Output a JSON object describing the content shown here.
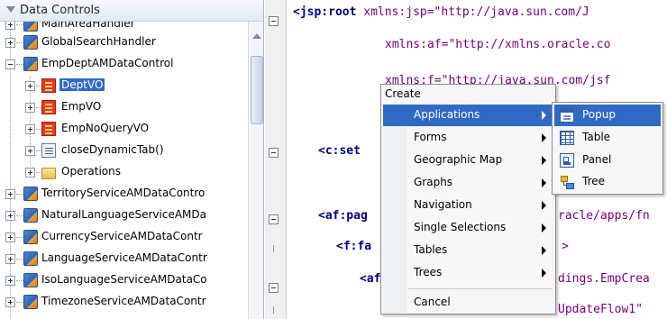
{
  "panel": {
    "title": "Data Controls"
  },
  "tree": {
    "items": [
      {
        "label": "MainAreaHandler",
        "icon": "data-control-icon"
      },
      {
        "label": "GlobalSearchHandler",
        "icon": "data-control-icon"
      },
      {
        "label": "EmpDeptAMDataControl",
        "icon": "data-control-icon"
      },
      {
        "label": "DeptVO",
        "icon": "view-object-icon",
        "selected": true
      },
      {
        "label": "EmpVO",
        "icon": "view-object-icon"
      },
      {
        "label": "EmpNoQueryVO",
        "icon": "view-object-icon"
      },
      {
        "label": "closeDynamicTab()",
        "icon": "method-icon"
      },
      {
        "label": "Operations",
        "icon": "folder-icon"
      },
      {
        "label": "TerritoryServiceAMDataContro",
        "icon": "data-control-icon"
      },
      {
        "label": "NaturalLanguageServiceAMDa",
        "icon": "data-control-icon"
      },
      {
        "label": "CurrencyServiceAMDataContr",
        "icon": "data-control-icon"
      },
      {
        "label": "LanguageServiceAMDataContr",
        "icon": "data-control-icon"
      },
      {
        "label": "IsoLanguageServiceAMDataCo",
        "icon": "data-control-icon"
      },
      {
        "label": "TimezoneServiceAMDataContr",
        "icon": "data-control-icon"
      }
    ]
  },
  "editor": {
    "lines": [
      {
        "tag": "<jsp:root",
        "rest": " xmlns:jsp=\"http://java.sun.com/J"
      },
      {
        "tag": "",
        "rest": "xmlns:af=\"http://xmlns.oracle.co"
      },
      {
        "tag": "",
        "rest": "xmlns:f=\"http://java.sun.com/jsf"
      },
      {
        "tag": "<c:set",
        "rest": ""
      },
      {
        "tag": "<af:pag",
        "rest": ""
      },
      {
        "tag": "<f:fa",
        "rest": ""
      },
      {
        "tag": "<af",
        "rest": ""
      },
      {
        "tag": "",
        "rest": "racle/apps/fn"
      },
      {
        "tag": "",
        "rest": ">"
      },
      {
        "tag": "",
        "rest": "dings.EmpCrea"
      },
      {
        "tag": "",
        "rest": "UpdateFlow1\""
      }
    ]
  },
  "context_menu": {
    "title": "Create",
    "items": [
      {
        "label": "Applications",
        "submenu": true,
        "active": true
      },
      {
        "label": "Forms",
        "submenu": true
      },
      {
        "label": "Geographic Map",
        "submenu": true
      },
      {
        "label": "Graphs",
        "submenu": true
      },
      {
        "label": "Navigation",
        "submenu": true
      },
      {
        "label": "Single Selections",
        "submenu": true
      },
      {
        "label": "Tables",
        "submenu": true
      },
      {
        "label": "Trees",
        "submenu": true
      }
    ],
    "cancel": "Cancel"
  },
  "submenu": {
    "items": [
      {
        "label": "Popup",
        "icon": "popup-icon",
        "active": true
      },
      {
        "label": "Table",
        "icon": "table-icon"
      },
      {
        "label": "Panel",
        "icon": "panel-icon"
      },
      {
        "label": "Tree",
        "icon": "tree-icon"
      }
    ]
  },
  "colors": {
    "selection": "#316ac5",
    "menu_bg": "#f7f7f7",
    "code_tag": "#000080",
    "code_value": "#0000ff"
  }
}
